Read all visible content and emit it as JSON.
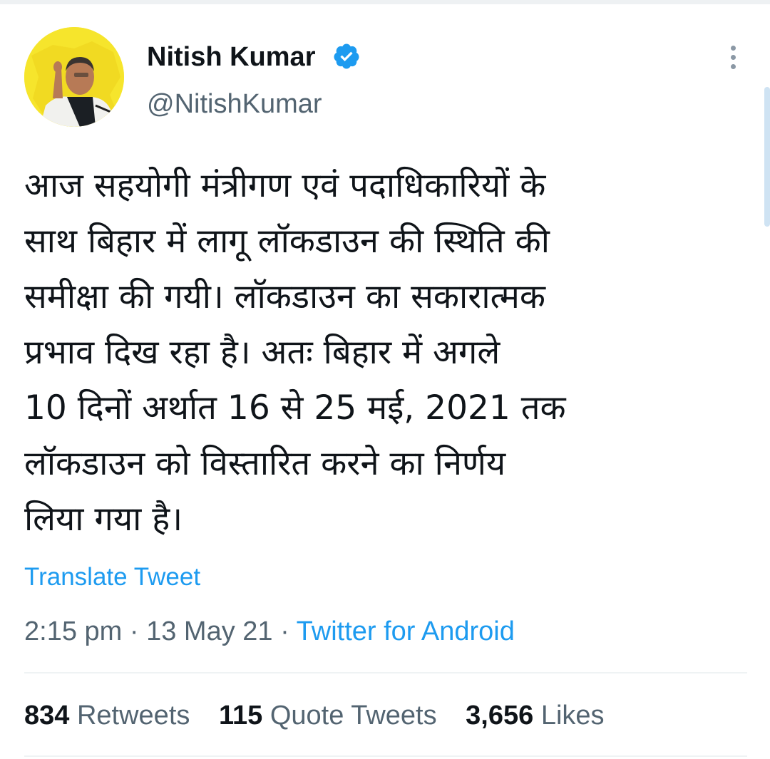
{
  "user": {
    "name": "Nitish Kumar",
    "handle": "@NitishKumar",
    "verified": true
  },
  "icons": {
    "avatar": "avatar-photo",
    "verified": "verified-badge-icon",
    "more": "more-options-icon"
  },
  "tweet": {
    "lines": [
      "आज सहयोगी मंत्रीगण एवं पदाधिकारियों के",
      "साथ बिहार में लागू लॉकडाउन की स्थिति की",
      "समीक्षा की गयी। लॉकडाउन का सकारात्मक",
      "प्रभाव दिख रहा है। अतः बिहार में अगले",
      "10 दिनों अर्थात 16 से 25 मई, 2021 तक",
      "लॉकडाउन को विस्तारित करने का निर्णय",
      "लिया गया है।"
    ],
    "translate_label": "Translate Tweet",
    "time": "2:15 pm",
    "date": "13 May 21",
    "separator": "·",
    "source": "Twitter for Android"
  },
  "stats": {
    "retweets": {
      "count": "834",
      "label": "Retweets"
    },
    "quote_tweets": {
      "count": "115",
      "label": "Quote Tweets"
    },
    "likes": {
      "count": "3,656",
      "label": "Likes"
    }
  },
  "colors": {
    "accent": "#1d9bf0",
    "secondary_text": "#536471",
    "primary_text": "#0f1419",
    "divider": "#eff3f4"
  }
}
